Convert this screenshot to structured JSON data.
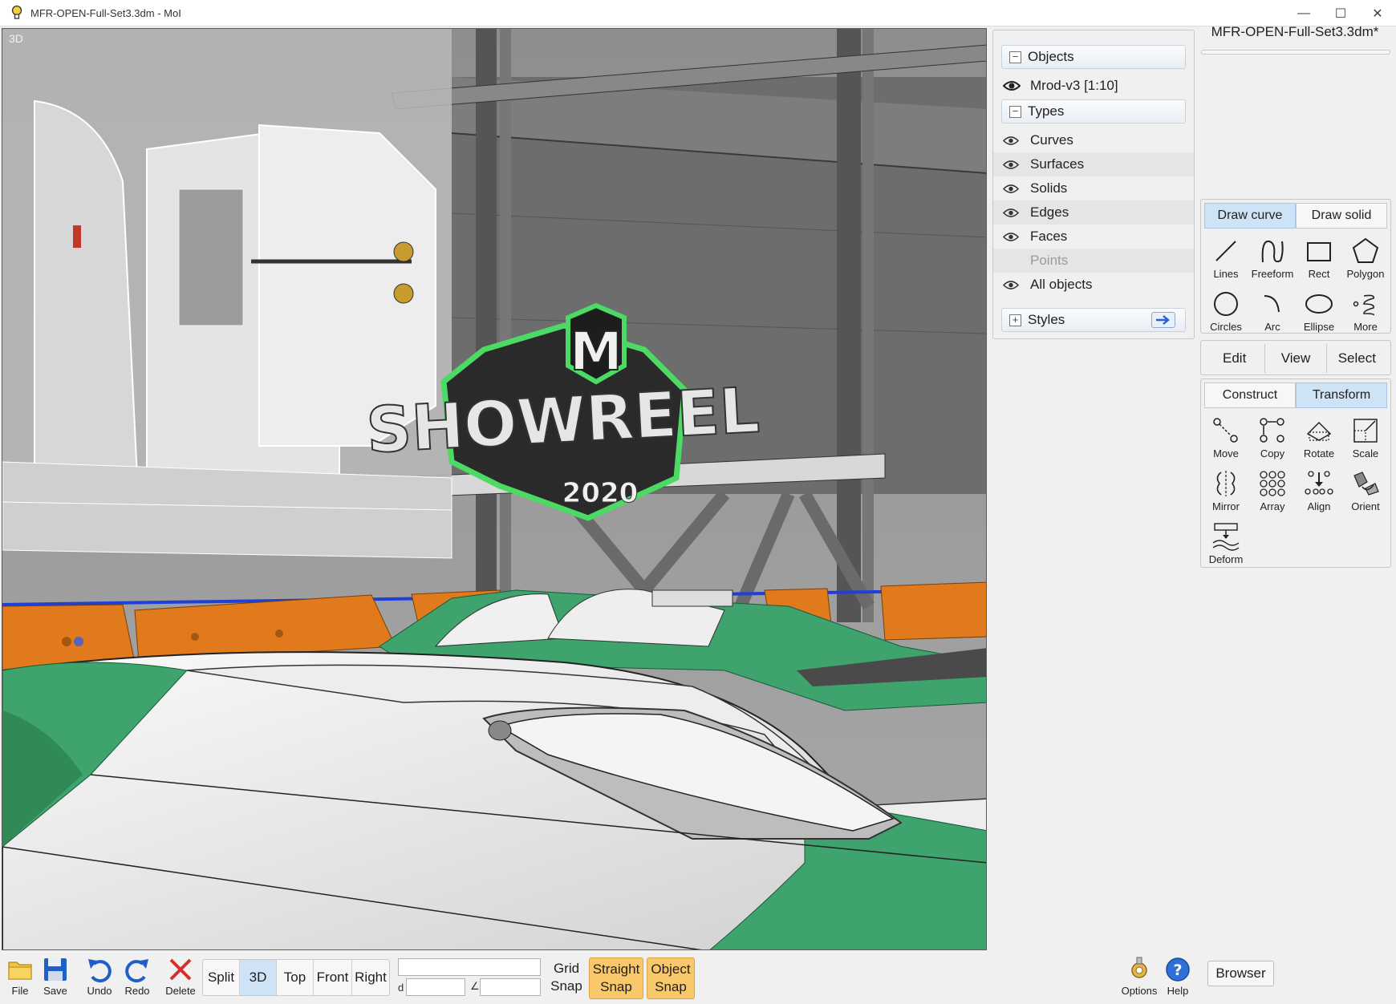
{
  "window": {
    "title": "MFR-OPEN-Full-Set3.3dm - MoI",
    "minimize": "—",
    "maximize": "☐",
    "close": "✕"
  },
  "viewport": {
    "label": "3D"
  },
  "scene": {
    "sign_letter": "M",
    "sign_text": "SHOWREEL",
    "sign_year": "2020"
  },
  "objects_panel": {
    "objects_header": "Objects",
    "object_name": "Mrod-v3 [1:10]",
    "types_header": "Types",
    "types": [
      "Curves",
      "Surfaces",
      "Solids",
      "Edges",
      "Faces",
      "Points",
      "All objects"
    ],
    "styles_header": "Styles"
  },
  "file_name": "MFR-OPEN-Full-Set3.3dm*",
  "draw_tabs": {
    "curve": "Draw curve",
    "solid": "Draw solid"
  },
  "draw_tools": [
    "Lines",
    "Freeform",
    "Rect",
    "Polygon",
    "Circles",
    "Arc",
    "Ellipse",
    "More"
  ],
  "mode_tabs": {
    "edit": "Edit",
    "view": "View",
    "select": "Select"
  },
  "transform_tabs": {
    "construct": "Construct",
    "transform": "Transform"
  },
  "transform_tools": [
    "Move",
    "Copy",
    "Rotate",
    "Scale",
    "Mirror",
    "Array",
    "Align",
    "Orient",
    "Deform"
  ],
  "bottom": {
    "file": "File",
    "save": "Save",
    "undo": "Undo",
    "redo": "Redo",
    "delete": "Delete",
    "views": [
      "Split",
      "3D",
      "Top",
      "Front",
      "Right"
    ],
    "distance_label": "d",
    "angle_label": "∠",
    "grid_snap": [
      "Grid",
      "Snap"
    ],
    "straight_snap": [
      "Straight",
      "Snap"
    ],
    "object_snap": [
      "Object",
      "Snap"
    ],
    "options": "Options",
    "help": "Help",
    "browser": "Browser"
  },
  "colors": {
    "accent_tab": "#cfe3f7",
    "snap_active": "#f8c86a",
    "model_green": "#3fa36d",
    "model_orange": "#e07a1c"
  }
}
